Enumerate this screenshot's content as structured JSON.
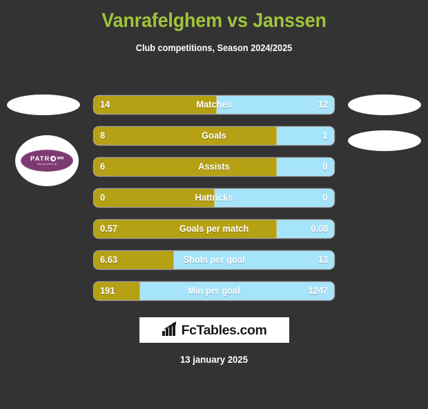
{
  "header": {
    "title": "Vanrafelghem vs Janssen",
    "subtitle": "Club competitions, Season 2024/2025",
    "title_color": "#a0c33c",
    "background_color": "#333333"
  },
  "crests": {
    "left_badge_text": "PATR",
    "left_badge_suffix": "WM",
    "left_badge_tagline": "Meer gedeeld in lijf",
    "left_badge_color": "#7d3a72"
  },
  "chart_data": {
    "type": "bar",
    "title": "Vanrafelghem vs Janssen",
    "subtitle": "Club competitions, Season 2024/2025",
    "orientation": "horizontal-diverging",
    "series": [
      {
        "name": "Vanrafelghem",
        "color": "#b6a014",
        "side": "left"
      },
      {
        "name": "Janssen",
        "color": "#a6e4fb",
        "side": "right"
      }
    ],
    "categories": [
      "Matches",
      "Goals",
      "Assists",
      "Hattricks",
      "Goals per match",
      "Shots per goal",
      "Min per goal"
    ],
    "rows": [
      {
        "label": "Matches",
        "left": "14",
        "right": "12",
        "left_pct": 51
      },
      {
        "label": "Goals",
        "left": "8",
        "right": "1",
        "left_pct": 76
      },
      {
        "label": "Assists",
        "left": "6",
        "right": "0",
        "left_pct": 76
      },
      {
        "label": "Hattricks",
        "left": "0",
        "right": "0",
        "left_pct": 50
      },
      {
        "label": "Goals per match",
        "left": "0.57",
        "right": "0.08",
        "left_pct": 76
      },
      {
        "label": "Shots per goal",
        "left": "6.63",
        "right": "13",
        "left_pct": 33
      },
      {
        "label": "Min per goal",
        "left": "191",
        "right": "1247",
        "left_pct": 19
      }
    ]
  },
  "footer": {
    "logo_text": "FcTables.com",
    "date": "13 january 2025"
  }
}
